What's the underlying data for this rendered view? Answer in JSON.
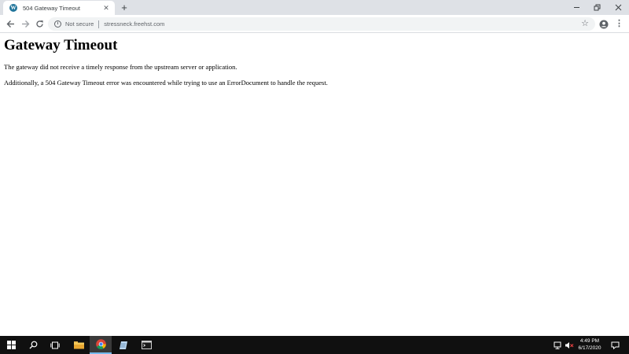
{
  "browser": {
    "tab": {
      "title": "504 Gateway Timeout",
      "favicon": "wordpress-icon"
    },
    "window_controls": [
      "minimize-icon",
      "restore-icon",
      "close-icon"
    ],
    "omnibox": {
      "security_label": "Not secure",
      "url": "stressneck.freehst.com"
    }
  },
  "page": {
    "heading": "Gateway Timeout",
    "paragraph_1": "The gateway did not receive a timely response from the upstream server or application.",
    "paragraph_2": "Additionally, a 504 Gateway Timeout error was encountered while trying to use an ErrorDocument to handle the request."
  },
  "taskbar": {
    "items": [
      "start-icon",
      "search-icon",
      "task-view-icon",
      "file-explorer-icon",
      "chrome-icon",
      "notepad-icon",
      "terminal-icon"
    ],
    "active_item": "chrome-icon",
    "clock": {
      "time": "4:49 PM",
      "date": "6/17/2020"
    }
  },
  "colors": {
    "tabstrip_bg": "#dee1e6",
    "omnibox_bg": "#f1f3f4",
    "taskbar_bg": "#101010",
    "active_underline": "#76b9ed"
  }
}
